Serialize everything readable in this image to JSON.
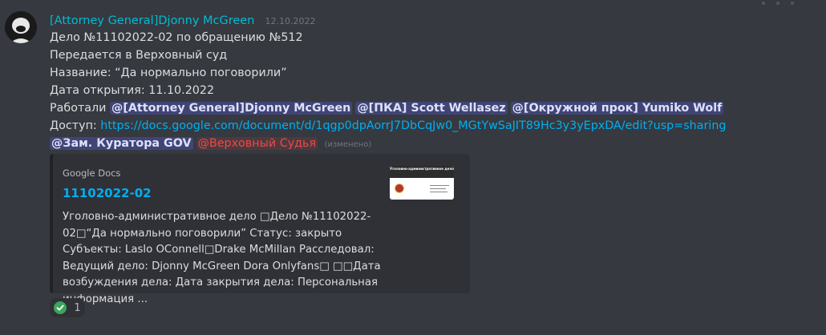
{
  "message": {
    "author": "[Attorney General]Djonny McGreen",
    "timestamp": "12.10.2022",
    "lines": {
      "case": "Дело №11102022-02 по обращению №512",
      "transfer": "Передается в Верховный суд",
      "title": "Название: “Да нормально поговорили”",
      "opened": "Дата открытия: 11.10.2022"
    },
    "worked_label": "Работали",
    "worked_mentions": [
      "@[Attorney General]Djonny McGreen",
      "@[ПКА] Scott Wellasez",
      "@[Окружной прок] Yumiko Wolf"
    ],
    "access_label": "Доступ:",
    "access_link": "https://docs.google.com/document/d/1qgp0dpAorrJ7DbCqJw0_MGtYwSaJIT89Hc3y3yEpxDA/edit?usp=sharing",
    "role_mentions": [
      "@Зам. Куратора GOV",
      "@Верховный Судья"
    ],
    "edited": "(изменено)"
  },
  "embed": {
    "provider": "Google Docs",
    "title": "11102022-02",
    "description": "Уголовно-административное дело □Дело №11102022-02□“Да нормально поговорили” Статус: закрыто Субъекты: Laslo OConnell□Drake McMillan Расследовал: Ведущий дело: Djonny McGreen Dora Onlyfans□ □□Дата возбуждения дела: Дата закрытия дела: Персональная информация ...",
    "thumb_title": "Уголовно-административное дело"
  },
  "reaction": {
    "icon": "check-icon",
    "count": "1"
  },
  "colors": {
    "author": "#00bcd4",
    "link": "#00aff4",
    "mention_bg": "#5865f24d",
    "role_red": "#f04747",
    "check": "#3ba55c"
  }
}
